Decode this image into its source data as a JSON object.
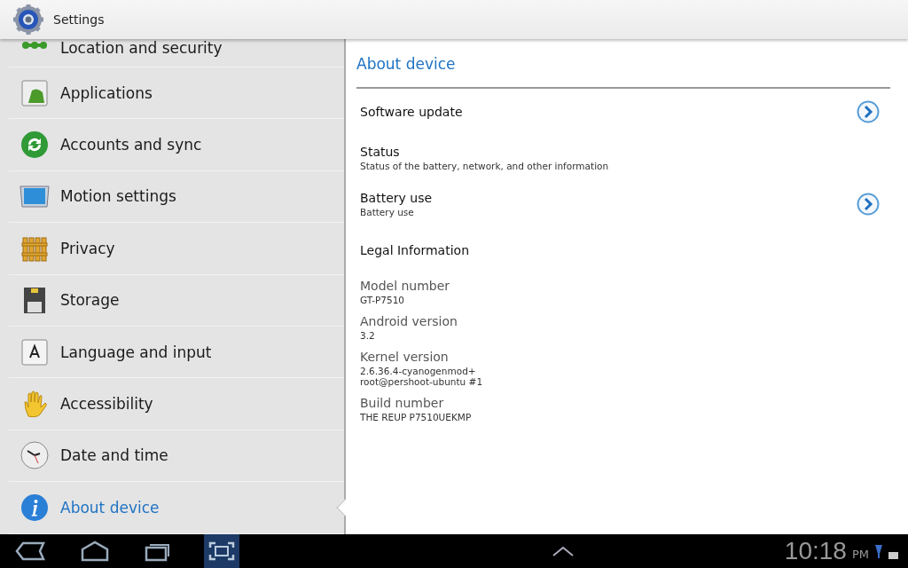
{
  "action_bar": {
    "title": "Settings"
  },
  "sidebar": {
    "items": [
      {
        "label": "Location and security",
        "kind": "location",
        "selected": false
      },
      {
        "label": "Applications",
        "kind": "apps",
        "selected": false
      },
      {
        "label": "Accounts and sync",
        "kind": "sync",
        "selected": false
      },
      {
        "label": "Motion settings",
        "kind": "motion",
        "selected": false
      },
      {
        "label": "Privacy",
        "kind": "privacy",
        "selected": false
      },
      {
        "label": "Storage",
        "kind": "storage",
        "selected": false
      },
      {
        "label": "Language and input",
        "kind": "language",
        "selected": false
      },
      {
        "label": "Accessibility",
        "kind": "hand",
        "selected": false
      },
      {
        "label": "Date and time",
        "kind": "clock",
        "selected": false
      },
      {
        "label": "About device",
        "kind": "info",
        "selected": true
      }
    ]
  },
  "detail": {
    "heading": "About device",
    "items": [
      {
        "kind": "nav",
        "title": "Software update",
        "chevron": true
      },
      {
        "kind": "nav",
        "title": "Status",
        "summary": "Status of the battery, network, and other information",
        "chevron": false
      },
      {
        "kind": "nav",
        "title": "Battery use",
        "summary": "Battery use",
        "chevron": true
      },
      {
        "kind": "nav",
        "title": "Legal Information",
        "chevron": false
      },
      {
        "kind": "info",
        "title": "Model number",
        "summary": "GT-P7510"
      },
      {
        "kind": "info",
        "title": "Android version",
        "summary": "3.2"
      },
      {
        "kind": "info",
        "title": "Kernel version",
        "summary": "2.6.36.4-cyanogenmod+\nroot@pershoot-ubuntu #1"
      },
      {
        "kind": "info",
        "title": "Build number",
        "summary": "THE REUP P7510UEKMP"
      }
    ]
  },
  "system_bar": {
    "time": "10:18",
    "ampm": "PM",
    "screenshot_active": true
  }
}
